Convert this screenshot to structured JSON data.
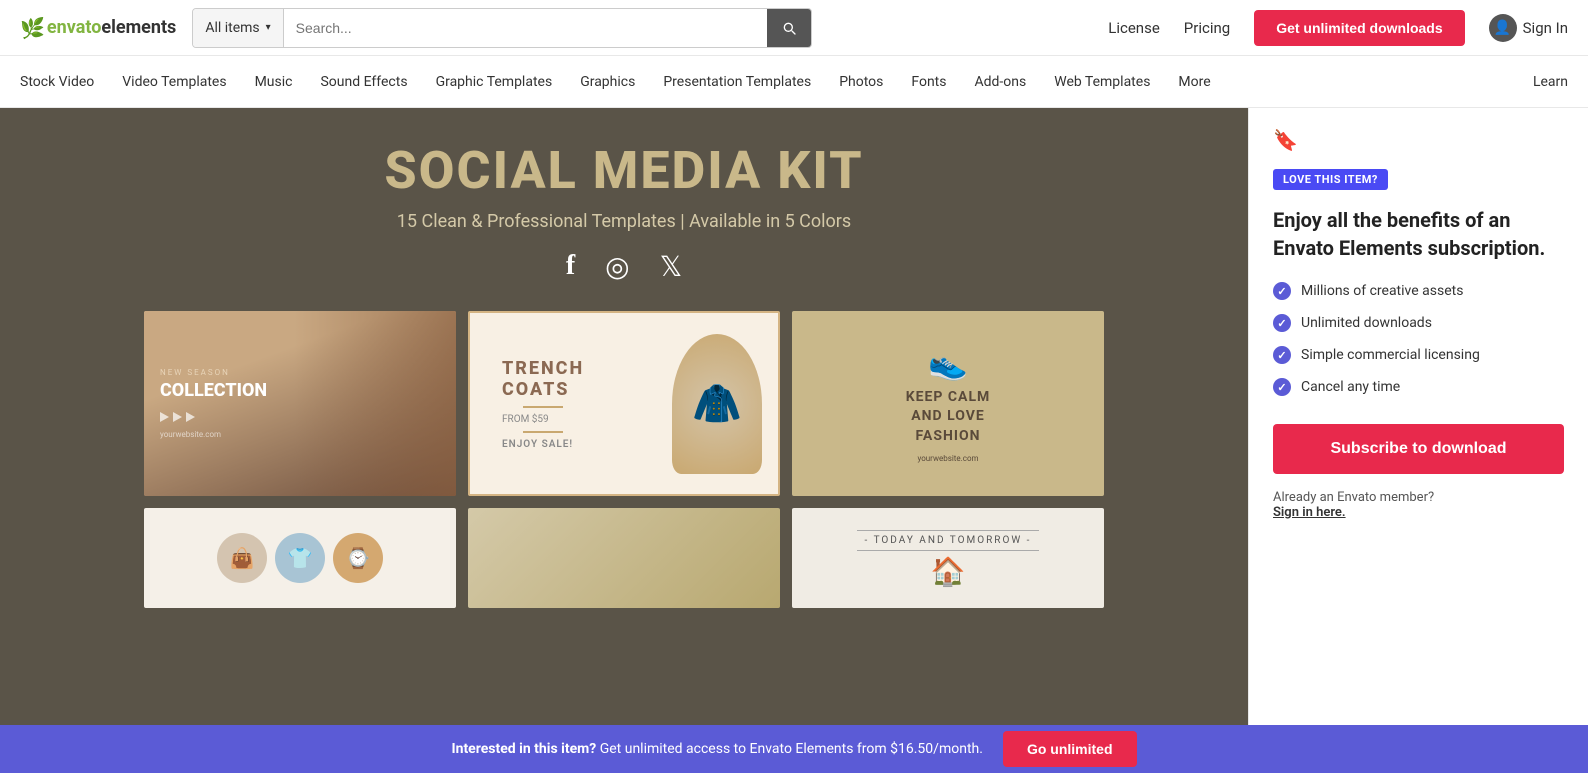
{
  "header": {
    "logo_envato": "envato",
    "logo_elements": "elements",
    "search_placeholder": "Search...",
    "search_dropdown": "All items",
    "nav_license": "License",
    "nav_pricing": "Pricing",
    "btn_unlimited": "Get unlimited downloads",
    "sign_in": "Sign In"
  },
  "sub_nav": {
    "items": [
      "Stock Video",
      "Video Templates",
      "Music",
      "Sound Effects",
      "Graphic Templates",
      "Graphics",
      "Presentation Templates",
      "Photos",
      "Fonts",
      "Add-ons",
      "Web Templates",
      "More"
    ],
    "learn": "Learn"
  },
  "preview": {
    "title_white": "SOCIAL",
    "title_gold": "MEDIA KIT",
    "subtitle": "15 Clean & Professional Templates | Available in 5 Colors"
  },
  "sidebar": {
    "love_badge": "LOVE THIS ITEM?",
    "heading": "Enjoy all the benefits of an Envato Elements subscription.",
    "benefits": [
      "Millions of creative assets",
      "Unlimited downloads",
      "Simple commercial licensing",
      "Cancel any time"
    ],
    "btn_subscribe": "Subscribe to download",
    "already_member": "Already an Envato member?",
    "sign_in_link": "Sign in here."
  },
  "bottom_bar": {
    "text_bold": "Interested in this item?",
    "text_normal": " Get unlimited access to Envato Elements from $16.50/month.",
    "btn_go": "Go unlimited"
  }
}
